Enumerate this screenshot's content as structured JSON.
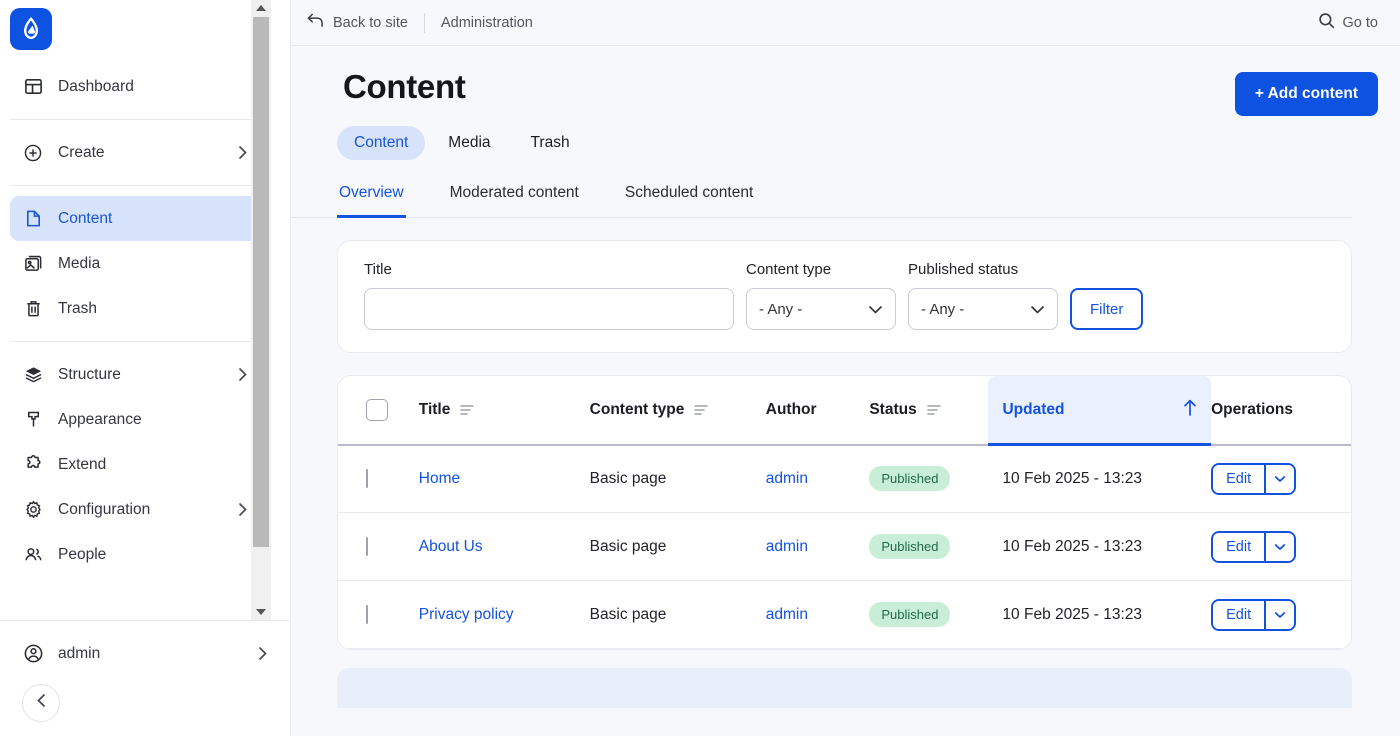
{
  "sidebar": {
    "logo_icon": "drupal-drop-icon",
    "groups": [
      {
        "items": [
          {
            "label": "Dashboard",
            "icon": "dashboard-icon",
            "chevron": false,
            "active": false
          }
        ]
      },
      {
        "items": [
          {
            "label": "Create",
            "icon": "plus-circle-icon",
            "chevron": true,
            "active": false
          }
        ]
      },
      {
        "items": [
          {
            "label": "Content",
            "icon": "document-icon",
            "chevron": false,
            "active": true
          },
          {
            "label": "Media",
            "icon": "image-stack-icon",
            "chevron": false,
            "active": false
          },
          {
            "label": "Trash",
            "icon": "trash-icon",
            "chevron": false,
            "active": false
          }
        ]
      },
      {
        "items": [
          {
            "label": "Structure",
            "icon": "layers-icon",
            "chevron": true,
            "active": false
          },
          {
            "label": "Appearance",
            "icon": "paint-roller-icon",
            "chevron": false,
            "active": false
          },
          {
            "label": "Extend",
            "icon": "puzzle-icon",
            "chevron": false,
            "active": false
          },
          {
            "label": "Configuration",
            "icon": "gear-icon",
            "chevron": true,
            "active": false
          },
          {
            "label": "People",
            "icon": "people-icon",
            "chevron": false,
            "active": false
          }
        ]
      }
    ],
    "account": {
      "label": "admin",
      "icon": "user-circle-icon",
      "chevron": true
    },
    "collapse_icon": "chevron-left-icon"
  },
  "topbar": {
    "back_label": "Back to site",
    "back_icon": "arrow-back-icon",
    "section_label": "Administration",
    "goto_label": "Go to",
    "goto_icon": "search-icon"
  },
  "header": {
    "title": "Content",
    "add_button": "+ Add content"
  },
  "pill_tabs": [
    {
      "label": "Content",
      "active": true
    },
    {
      "label": "Media",
      "active": false
    },
    {
      "label": "Trash",
      "active": false
    }
  ],
  "sub_tabs": [
    {
      "label": "Overview",
      "active": true
    },
    {
      "label": "Moderated content",
      "active": false
    },
    {
      "label": "Scheduled content",
      "active": false
    }
  ],
  "filters": {
    "title": {
      "label": "Title",
      "value": "",
      "placeholder": ""
    },
    "content_type": {
      "label": "Content type",
      "value": "- Any -"
    },
    "published_status": {
      "label": "Published status",
      "value": "- Any -"
    },
    "submit_label": "Filter"
  },
  "table": {
    "columns": [
      {
        "key": "check",
        "label": "",
        "sortable": false,
        "sorted": false
      },
      {
        "key": "title",
        "label": "Title",
        "sortable": true,
        "sorted": false
      },
      {
        "key": "type",
        "label": "Content type",
        "sortable": true,
        "sorted": false
      },
      {
        "key": "author",
        "label": "Author",
        "sortable": false,
        "sorted": false
      },
      {
        "key": "status",
        "label": "Status",
        "sortable": true,
        "sorted": false
      },
      {
        "key": "updated",
        "label": "Updated",
        "sortable": true,
        "sorted": true,
        "sort_direction": "ascending"
      },
      {
        "key": "ops",
        "label": "Operations",
        "sortable": false,
        "sorted": false
      }
    ],
    "rows": [
      {
        "title": "Home",
        "type": "Basic page",
        "author": "admin",
        "status": "Published",
        "updated": "10 Feb 2025 - 13:23",
        "edit_label": "Edit"
      },
      {
        "title": "About Us",
        "type": "Basic page",
        "author": "admin",
        "status": "Published",
        "updated": "10 Feb 2025 - 13:23",
        "edit_label": "Edit"
      },
      {
        "title": "Privacy policy",
        "type": "Basic page",
        "author": "admin",
        "status": "Published",
        "updated": "10 Feb 2025 - 13:23",
        "edit_label": "Edit"
      }
    ]
  },
  "colors": {
    "brand_blue": "#0d52e0",
    "link_blue": "#1452e0",
    "active_nav_bg": "#d6e3fb",
    "page_bg": "#f7f8fc",
    "badge_green_bg": "#c9eed8",
    "badge_green_text": "#1f6b45",
    "sorted_col_bg": "#eaf0fd"
  }
}
